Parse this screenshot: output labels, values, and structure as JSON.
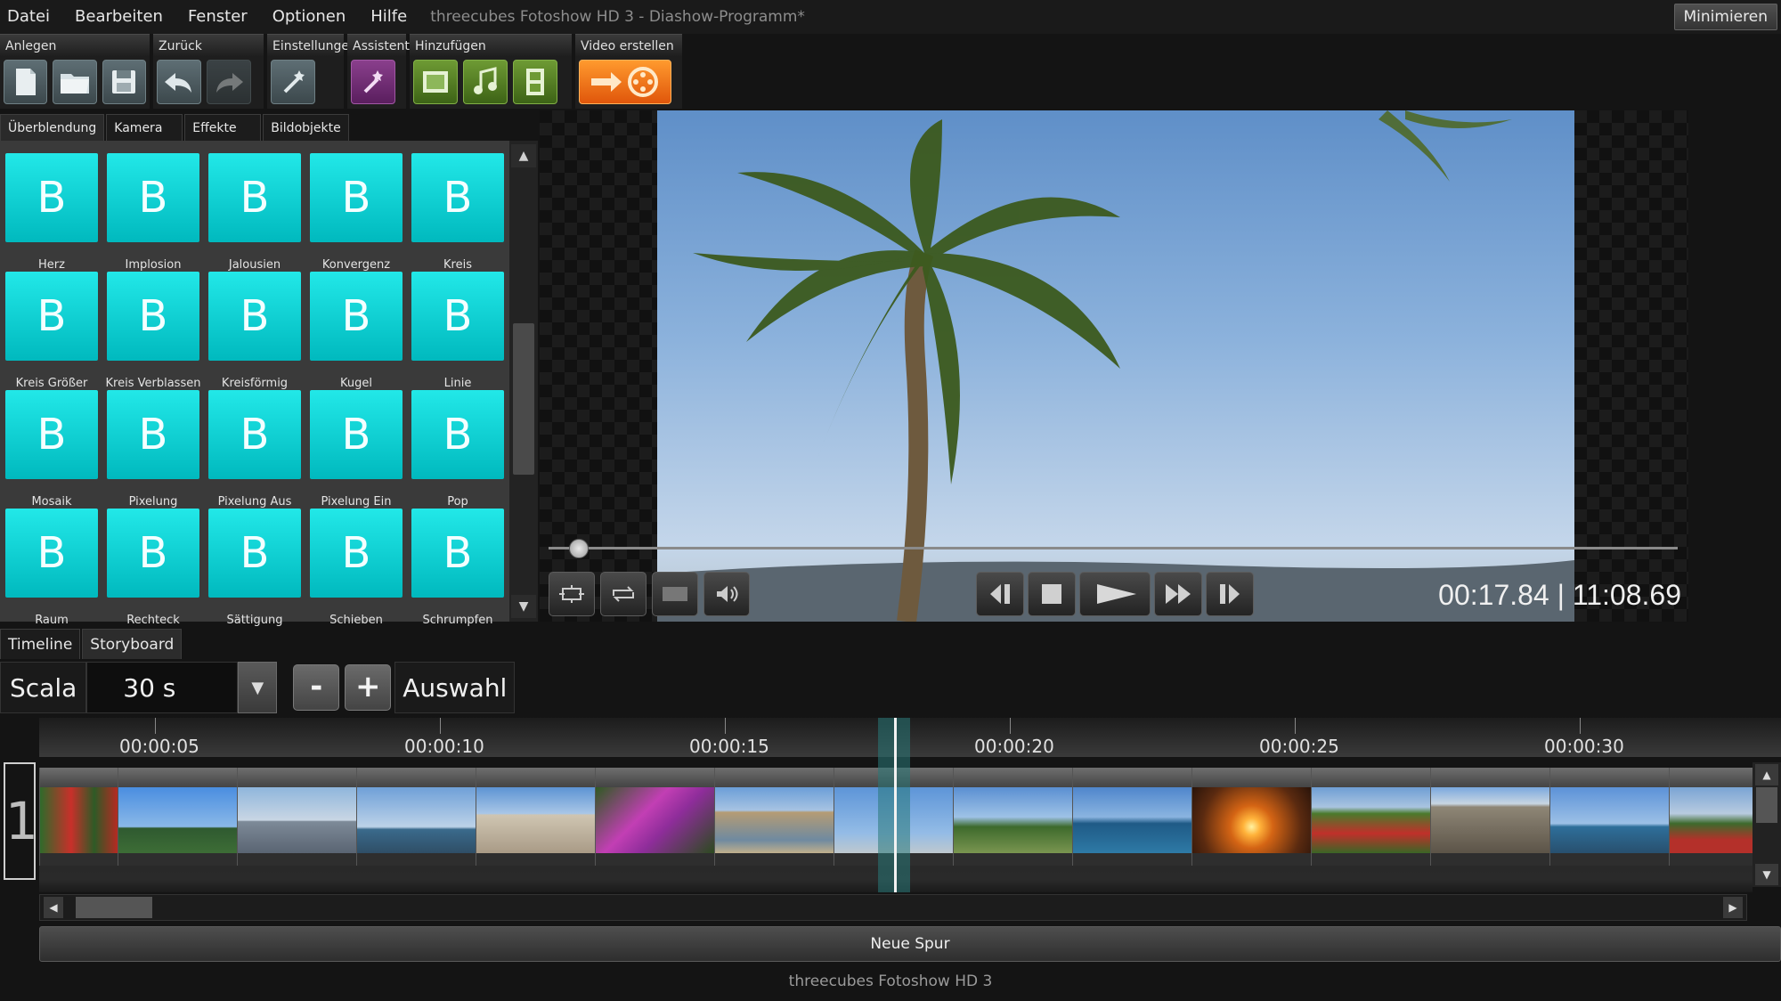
{
  "menu": {
    "items": [
      "Datei",
      "Bearbeiten",
      "Fenster",
      "Optionen",
      "Hilfe"
    ],
    "title": "threecubes Fotoshow HD 3 - Diashow-Programm*",
    "minimize_label": "Minimieren"
  },
  "toolbar": {
    "groups": [
      {
        "label": "Anlegen",
        "buttons": [
          "new-document-icon",
          "open-folder-icon",
          "save-icon"
        ]
      },
      {
        "label": "Zurück",
        "buttons": [
          "undo-icon",
          "redo-icon"
        ]
      },
      {
        "label": "Einstellungen",
        "buttons": [
          "settings-wand-icon"
        ]
      },
      {
        "label": "Assistent",
        "buttons": [
          "magic-wand-icon"
        ]
      },
      {
        "label": "Hinzufügen",
        "buttons": [
          "add-image-icon",
          "add-music-icon",
          "add-video-icon"
        ]
      },
      {
        "label": "Video erstellen",
        "buttons": [
          "create-video-icon"
        ]
      }
    ]
  },
  "effect_tabs": [
    "Überblendung",
    "Kamera",
    "Effekte",
    "Bildobjekte"
  ],
  "effects": {
    "tile_letter": "B",
    "items": [
      "Herz",
      "Implosion",
      "Jalousien",
      "Konvergenz",
      "Kreis",
      "Kreis Größer",
      "Kreis Verblassen",
      "Kreisförmig",
      "Kugel",
      "Linie",
      "Mosaik",
      "Pixelung",
      "Pixelung Aus",
      "Pixelung Ein",
      "Pop",
      "Raum",
      "Rechteck",
      "Sättigung",
      "Schieben",
      "Schrumpfen"
    ]
  },
  "player": {
    "current_time": "00:17.84",
    "separator": "|",
    "total_time": "11:08.69",
    "progress_fraction": 0.027,
    "buttons": [
      "fit-icon",
      "loop-icon",
      "fullscreen-icon",
      "volume-icon",
      "previous-icon",
      "stop-icon",
      "play-icon",
      "fast-forward-icon",
      "next-icon"
    ]
  },
  "view_tabs": [
    "Timeline",
    "Storyboard"
  ],
  "scale": {
    "label": "Scala",
    "value": "30 s",
    "minus": "-",
    "plus": "+",
    "selection_label": "Auswahl"
  },
  "timeline": {
    "ruler_labels": [
      "00:00:05",
      "00:00:10",
      "00:00:15",
      "00:00:20",
      "00:00:25",
      "00:00:30"
    ],
    "track_number": "1",
    "new_track_label": "Neue Spur"
  },
  "footer": "threecubes Fotoshow HD 3",
  "colors": {
    "accent_cyan": "#00c8cc",
    "create_video_orange": "#f07a1a",
    "background": "#141414"
  }
}
